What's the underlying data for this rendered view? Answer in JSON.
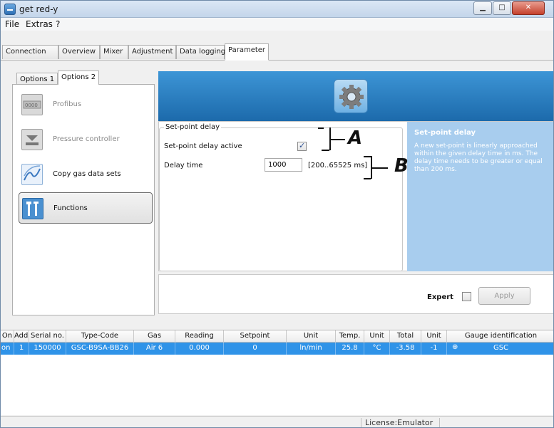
{
  "window": {
    "title": "get red-y"
  },
  "menu": {
    "items": [
      "File",
      "Extras",
      "?"
    ]
  },
  "tabs": [
    "Connection",
    "Overview",
    "Mixer",
    "Adjustment",
    "Data logging",
    "Parameter"
  ],
  "subtabs": [
    "Options 1",
    "Options 2"
  ],
  "nav": [
    {
      "label": "Profibus",
      "enabled": false
    },
    {
      "label": "Pressure controller",
      "enabled": false
    },
    {
      "label": "Copy gas data sets",
      "enabled": true
    },
    {
      "label": "Functions",
      "enabled": true,
      "selected": true
    }
  ],
  "setpoint": {
    "group_title": "Set-point delay",
    "active_label": "Set-point delay active",
    "active_checked": true,
    "delay_label": "Delay time",
    "delay_value": "1000",
    "delay_range": "[200..65525 ms]"
  },
  "help": {
    "title": "Set-point delay",
    "text": "A new set-point is linearly approached within the given delay time in ms. The delay time needs to be greater or equal than 200 ms."
  },
  "annotations": [
    "A",
    "B"
  ],
  "bottom": {
    "expert_label": "Expert",
    "apply_label": "Apply"
  },
  "grid": {
    "headers": [
      "On",
      "Addr.",
      "Serial no.",
      "Type-Code",
      "Gas",
      "Reading",
      "Setpoint",
      "Unit",
      "Temp.",
      "Unit",
      "Total",
      "Unit",
      "Gauge identification"
    ],
    "rows": [
      [
        "on",
        "1",
        "150000",
        "GSC-B9SA-BB26",
        "Air 6",
        "0.000",
        "0",
        "ln/min",
        "25.8",
        "°C",
        "-3.58",
        "-1",
        "GSC"
      ]
    ]
  },
  "status": {
    "license": "License:Emulator"
  },
  "colors": {
    "accent": "#2f93e8",
    "banner": "#1c6aab",
    "help_bg": "#a8cdee"
  }
}
